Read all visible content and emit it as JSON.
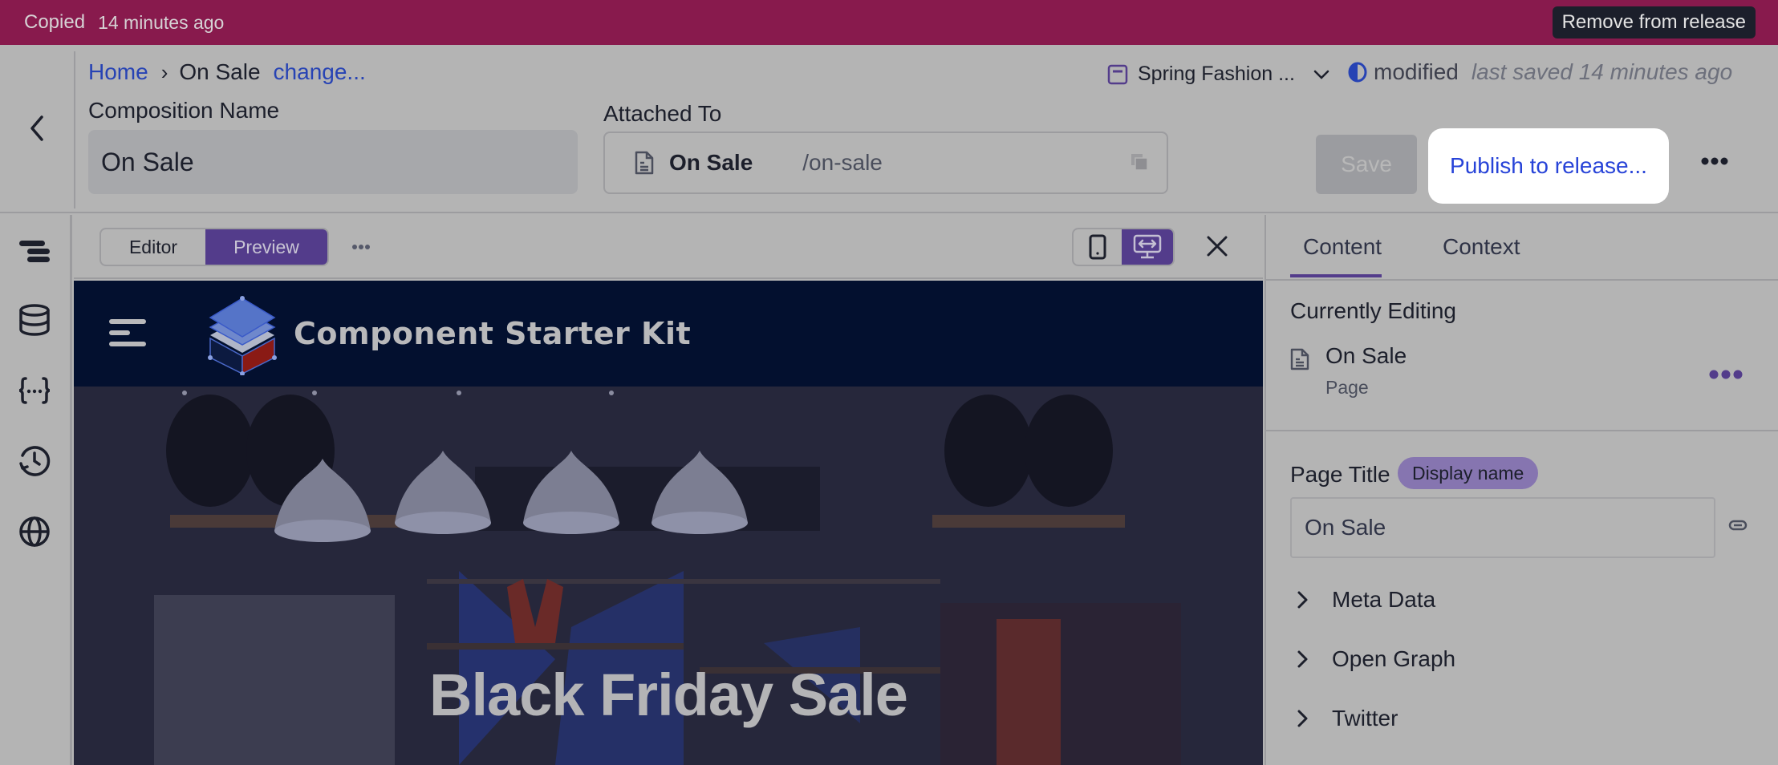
{
  "banner": {
    "status": "Copied",
    "time": "14 minutes ago",
    "remove_label": "Remove from release",
    "color": "#881a4d"
  },
  "header": {
    "breadcrumb": {
      "home": "Home",
      "separator": "›",
      "current": "On Sale",
      "change": "change..."
    },
    "composition_name_label": "Composition Name",
    "composition_name_value": "On Sale",
    "attached_to_label": "Attached To",
    "attached": {
      "name": "On Sale",
      "path": "/on-sale"
    },
    "release": {
      "selected": "Spring Fashion ..."
    },
    "status": {
      "state": "modified",
      "saved": "last saved 14 minutes ago"
    },
    "save_label": "Save",
    "publish_label": "Publish to release..."
  },
  "rail": {
    "items": [
      {
        "icon": "structure-icon"
      },
      {
        "icon": "database-icon"
      },
      {
        "icon": "variables-icon"
      },
      {
        "icon": "history-icon"
      },
      {
        "icon": "globe-icon"
      }
    ]
  },
  "preview_toolbar": {
    "modes": [
      "Editor",
      "Preview"
    ],
    "active_mode": "Preview",
    "active_device": "desktop"
  },
  "site": {
    "brand": "Component Starter Kit",
    "hero_title": "Black Friday Sale"
  },
  "right_panel": {
    "tabs": [
      "Content",
      "Context"
    ],
    "active_tab": "Content",
    "currently_editing_label": "Currently Editing",
    "current_item": {
      "name": "On Sale",
      "type": "Page"
    },
    "page_title_label": "Page Title",
    "page_title_badge": "Display name",
    "page_title_value": "On Sale",
    "sections": [
      "Meta Data",
      "Open Graph",
      "Twitter"
    ]
  },
  "colors": {
    "accent": "#533c8b",
    "link": "#2743b4",
    "badge": "#8675b0"
  }
}
